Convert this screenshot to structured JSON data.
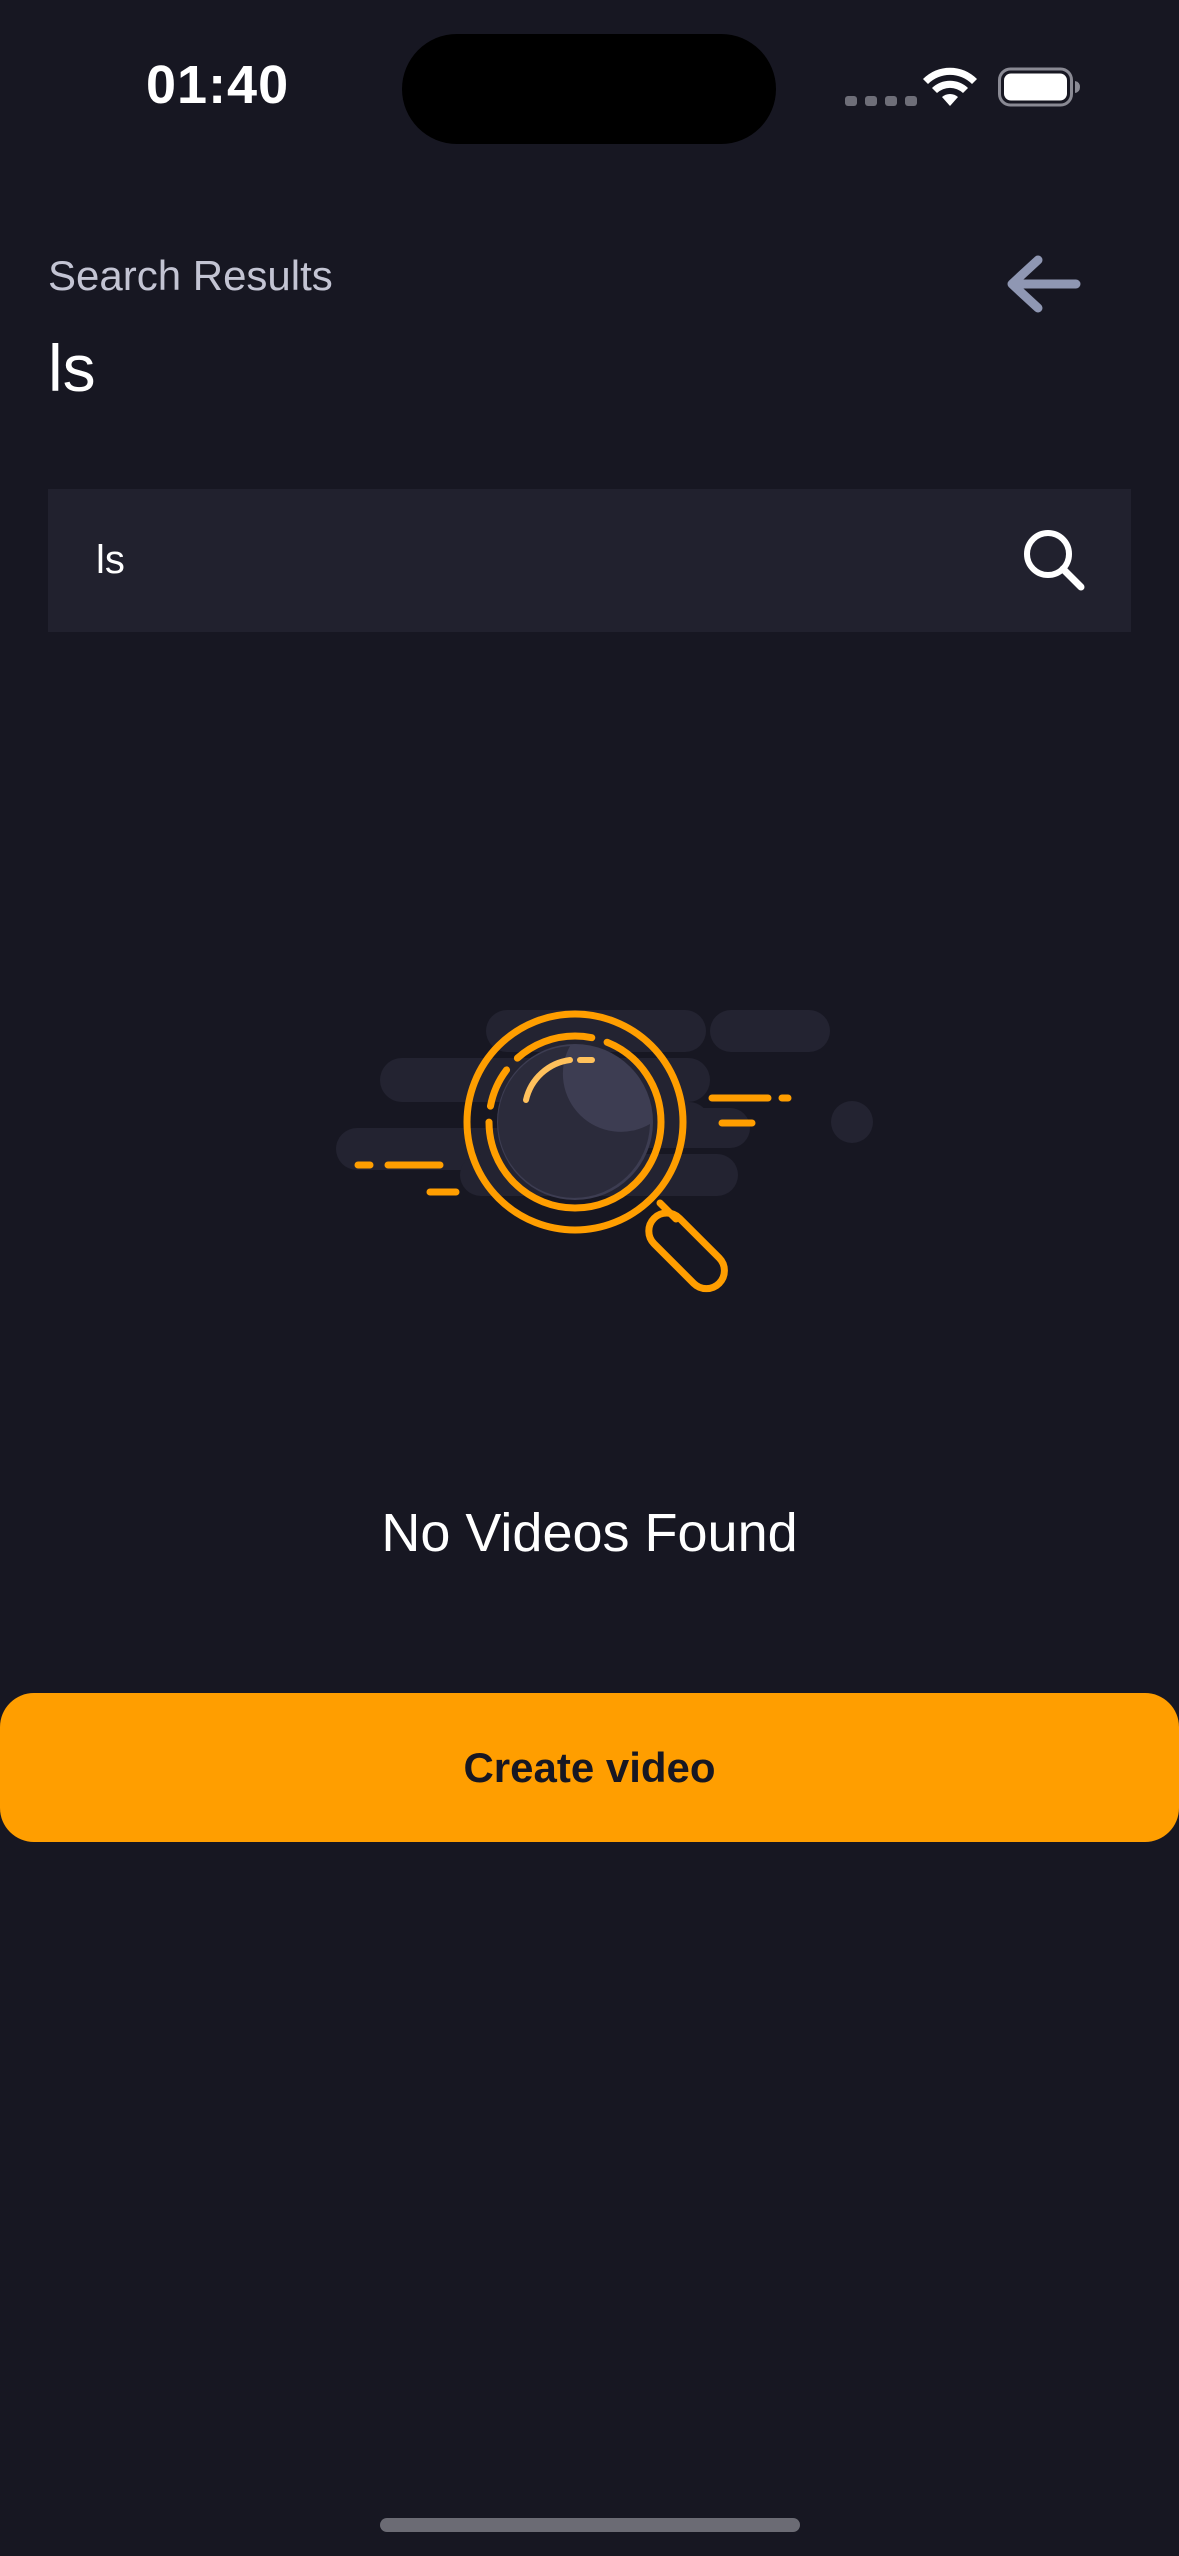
{
  "status_bar": {
    "time": "01:40",
    "icons": [
      "signal-dots-icon",
      "wifi-icon",
      "battery-icon"
    ]
  },
  "header": {
    "subtitle": "Search Results",
    "title": "ls",
    "back_icon": "arrow-left-icon"
  },
  "search": {
    "value": "ls",
    "icon": "search-icon"
  },
  "empty_state": {
    "illustration": "magnifying-glass-icon",
    "message": "No Videos Found"
  },
  "actions": {
    "create_label": "Create video"
  },
  "colors": {
    "background": "#171722",
    "search_field": "#21212e",
    "accent": "#ff9e00",
    "subtitle_text": "#c3c4d3",
    "back_arrow": "#8f97b3"
  }
}
